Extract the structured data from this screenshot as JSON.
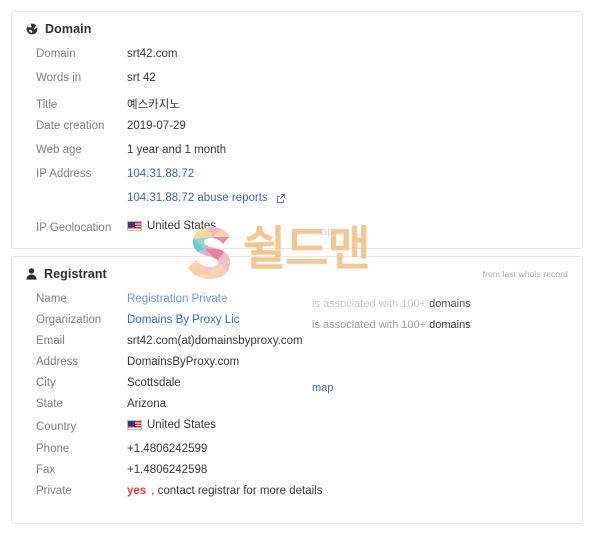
{
  "domain_panel": {
    "title": "Domain",
    "icon": "globe-icon",
    "rows": [
      {
        "label": "Domain",
        "value": "srt42.com"
      },
      {
        "label": "Words in",
        "value": "srt 42"
      },
      {
        "label": "Title",
        "value": "예스카지노"
      },
      {
        "label": "Date creation",
        "value": "2019-07-29"
      },
      {
        "label": "Web age",
        "value": "1 year and 1 month"
      }
    ],
    "ip_address_label": "IP Address",
    "ip_address": "104.31.88.72",
    "ip_abuse_reports": "104.31.88.72 abuse reports",
    "geo_label": "IP Geolocation",
    "geo_country": "United States",
    "geo_map_link": "map"
  },
  "registrant_panel": {
    "title": "Registrant",
    "icon": "user-icon",
    "note": "from last whois record",
    "name_label": "Name",
    "name_value": "Registration Private",
    "name_assoc_prefix": "is associated with 100+",
    "name_assoc_suffix": "domains",
    "org_label": "Organization",
    "org_value": "Domains By Proxy Lic",
    "org_assoc_prefix": "is associated with 100+",
    "org_assoc_suffix": "domains",
    "email_label": "Email",
    "email_value": "srt42.com(at)domainsbyproxy.com",
    "address_label": "Address",
    "address_value": "DomainsByProxy.com",
    "city_label": "City",
    "city_value": "Scottsdale",
    "city_map_link": "map",
    "state_label": "State",
    "state_value": "Arizona",
    "country_label": "Country",
    "country_value": "United States",
    "phone_label": "Phone",
    "phone_value": "+1.4806242599",
    "fax_label": "Fax",
    "fax_value": "+1.4806242598",
    "private_label": "Private",
    "private_yes": "yes",
    "private_rest": ", contact registrar for more details"
  },
  "watermark": {
    "text": "쉴드맨",
    "logo": "letter-s-logo",
    "text_color": "#f6c690"
  },
  "colors": {
    "link": "#3a6fb0",
    "label": "#7b8187",
    "value": "#35393d",
    "danger": "#e03b3b",
    "panel_border": "#e6e8ea"
  }
}
